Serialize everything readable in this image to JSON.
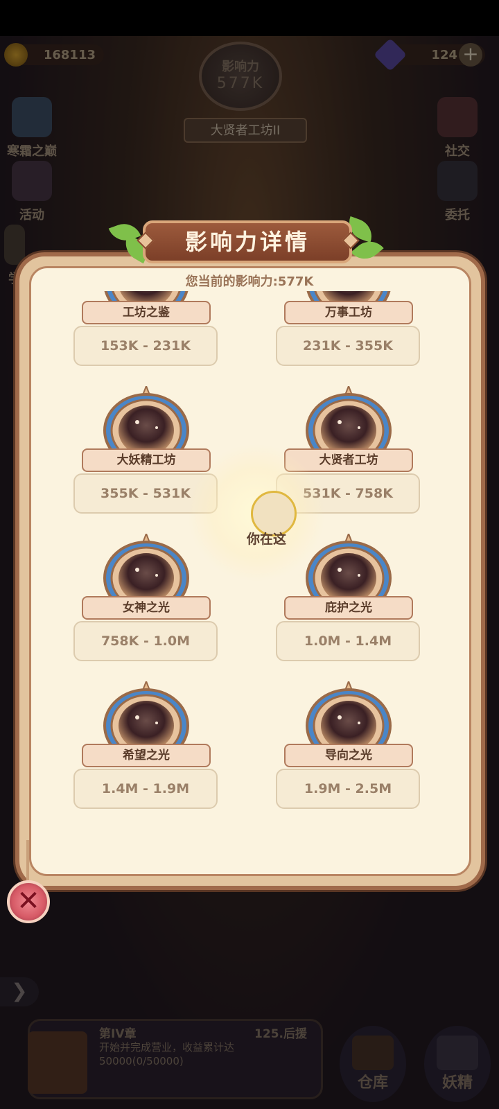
{
  "top_bar": {
    "gold": "168113",
    "gems": "124",
    "influence_label": "影响力",
    "influence_value": "577K",
    "workshop_name": "大贤者工坊II"
  },
  "side_left": [
    "寒霜之巅",
    "活动",
    "学"
  ],
  "side_right": [
    "社交",
    "委托"
  ],
  "dialog": {
    "title": "影响力详情",
    "current_influence": "您当前的影响力:577K",
    "you_are_here": "你在这",
    "tiers": [
      {
        "name": "工坊之鉴",
        "range": "153K - 231K"
      },
      {
        "name": "万事工坊",
        "range": "231K - 355K"
      },
      {
        "name": "大妖精工坊",
        "range": "355K - 531K"
      },
      {
        "name": "大贤者工坊",
        "range": "531K - 758K"
      },
      {
        "name": "女神之光",
        "range": "758K - 1.0M"
      },
      {
        "name": "庇护之光",
        "range": "1.0M - 1.4M"
      },
      {
        "name": "希望之光",
        "range": "1.4M - 1.9M"
      },
      {
        "name": "导向之光",
        "range": "1.9M - 2.5M"
      }
    ],
    "close_label": "✕"
  },
  "quest": {
    "chapter": "第IV章",
    "stage": "125.后援",
    "description": "开始并完成营业，收益累计达50000(0/50000)"
  },
  "bottom_buttons": [
    "仓库",
    "妖精"
  ],
  "colors": {
    "panel_bg": "#fbf3df",
    "title_ribbon": "#8c4a30",
    "badge_blue": "#4a86c8",
    "close_red": "#d65a66"
  }
}
